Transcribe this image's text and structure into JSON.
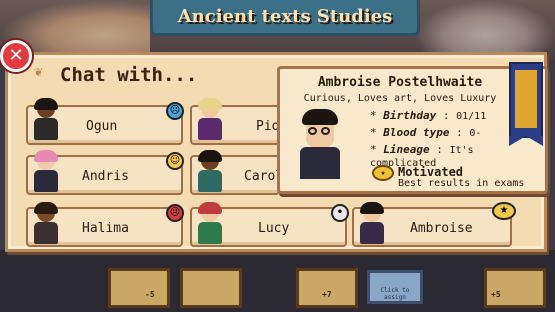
{
  "background": {
    "title": "Ancient texts Studies",
    "assign_label": "Click to assign",
    "costs": [
      "-5",
      "+7",
      "+5"
    ]
  },
  "dialog": {
    "title": "Chat with...",
    "close_icon": "close-icon"
  },
  "characters": [
    {
      "name": "Ogun",
      "mood": "sad",
      "mood_color": "#4aa3d8"
    },
    {
      "name": "Pio",
      "mood": "none",
      "mood_color": ""
    },
    {
      "name": "Andris",
      "mood": "happy",
      "mood_color": "#f2c94c"
    },
    {
      "name": "Carol",
      "mood": "none",
      "mood_color": ""
    },
    {
      "name": "Halima",
      "mood": "angry",
      "mood_color": "#d23b3b"
    },
    {
      "name": "Lucy",
      "mood": "neutral",
      "mood_color": "#e8e8e8"
    },
    {
      "name": "Ambroise",
      "mood": "motivated",
      "mood_color": "#f2c94c"
    }
  ],
  "selected": {
    "full_name": "Ambroise Postelhwaite",
    "traits": "Curious, Loves art, Loves Luxury",
    "birthday_label": "Birthday",
    "birthday_value": "01/11",
    "blood_label": "Blood type",
    "blood_value": "0-",
    "lineage_label": "Lineage",
    "lineage_value": "It's complicated",
    "status_title": "Motivated",
    "status_desc": "Best results in exams"
  },
  "colors": {
    "parchment": "#f3dcb2",
    "border": "#b8895a",
    "close": "#e23a3f",
    "banner": "#2b3f88"
  }
}
